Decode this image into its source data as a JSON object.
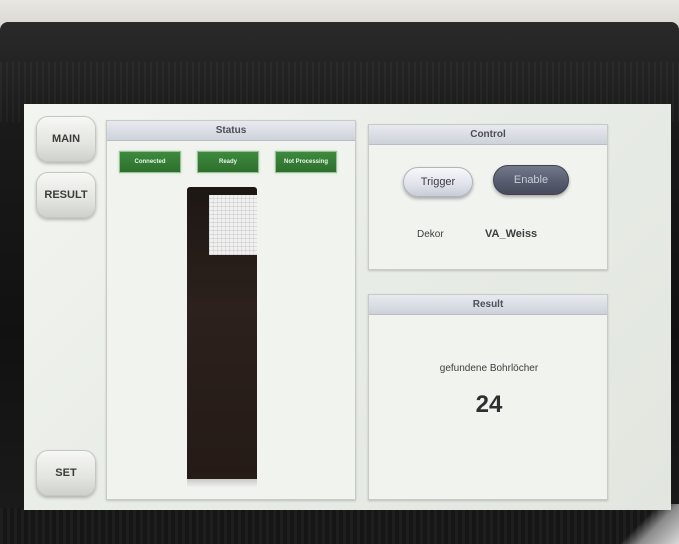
{
  "nav": {
    "main_label": "MAIN",
    "result_label": "RESULT",
    "set_label": "SET"
  },
  "status_panel": {
    "title": "Status",
    "badges": [
      {
        "label": "Connected"
      },
      {
        "label": "Ready"
      },
      {
        "label": "Not Processing"
      }
    ]
  },
  "control_panel": {
    "title": "Control",
    "trigger_label": "Trigger",
    "enable_label": "Enable",
    "dekor_label": "Dekor",
    "dekor_value": "VA_Weiss"
  },
  "result_panel": {
    "title": "Result",
    "description": "gefundene Bohrlöcher",
    "count": "24"
  },
  "colors": {
    "status_green": "#2d6f2d",
    "enable_button": "#555a6d",
    "screen_background": "#e8ece6"
  }
}
